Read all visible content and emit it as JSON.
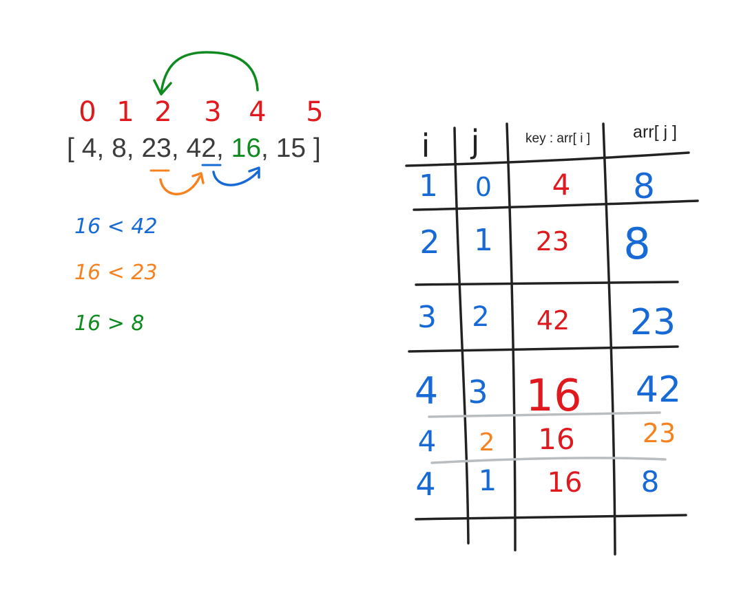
{
  "colors": {
    "red": "#e0191e",
    "blue": "#1769d6",
    "orange": "#f5821f",
    "green": "#0e8a1f",
    "ink": "#222222",
    "text": "#3c3c3c",
    "gray": "#b9bdbf"
  },
  "array": {
    "indices": [
      "0",
      "1",
      "2",
      "3",
      "4",
      "5"
    ],
    "open_bracket": "[",
    "close_bracket": "]",
    "values": [
      "4",
      "8",
      "23",
      "42",
      "16",
      "15"
    ],
    "separator": ","
  },
  "comparisons": [
    {
      "text": "16 < 42",
      "color": "blue"
    },
    {
      "text": "16 < 23",
      "color": "orange"
    },
    {
      "text": "16 > 8",
      "color": "green"
    }
  ],
  "table": {
    "headers": {
      "i": "i",
      "j": "j",
      "key": "key : arr[ i ]",
      "arr_j": "arr[ j ]"
    },
    "rows": [
      {
        "i": "1",
        "j": "0",
        "key": "4",
        "arr_j": "8"
      },
      {
        "i": "2",
        "j": "1",
        "key": "23",
        "arr_j": "8"
      },
      {
        "i": "3",
        "j": "2",
        "key": "42",
        "arr_j": "23"
      },
      {
        "i": "4",
        "j": "3",
        "key": "16",
        "arr_j": "42"
      },
      {
        "i": "4",
        "j": "2",
        "key": "16",
        "arr_j": "23"
      },
      {
        "i": "4",
        "j": "1",
        "key": "16",
        "arr_j": "8"
      }
    ]
  }
}
